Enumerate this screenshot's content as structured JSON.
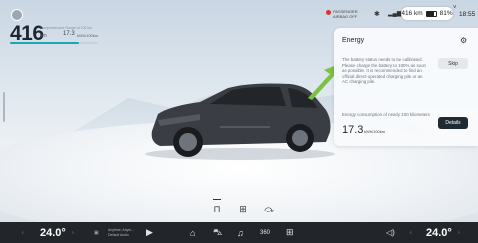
{
  "status": {
    "range_value": "416",
    "range_unit": "km",
    "range_caption": "Comprehensive Range at 100 km",
    "secondary_value": "17.3",
    "secondary_unit": "kWh/100km",
    "passenger_airbag": "PASSENGER\nAIRBAG OFF",
    "range_pill": "416 km",
    "battery_pct": "81%",
    "time": "18:55"
  },
  "energy_panel": {
    "title": "Energy",
    "message": "The battery status needs to be calibrated. Please charge the battery to 100% as soon as possible. It is recommended to find an official direct-operated charging pile or an AC charging pile.",
    "skip_label": "Skip",
    "consumption_label": "Energy consumption of nearly 100 kilometers",
    "consumption_value": "17.3",
    "consumption_unit": "kWh/100km",
    "details_label": "Details"
  },
  "bottom_bar": {
    "left_temp": "24.0°",
    "right_temp": "24.0°",
    "media_title": "Anytime, Anyw...",
    "media_subtitle": "Default Audio"
  },
  "colors": {
    "accent": "#1aa6b5",
    "arrow": "#7cc242",
    "dock": "#22262b",
    "details_button": "#1e2a34"
  }
}
